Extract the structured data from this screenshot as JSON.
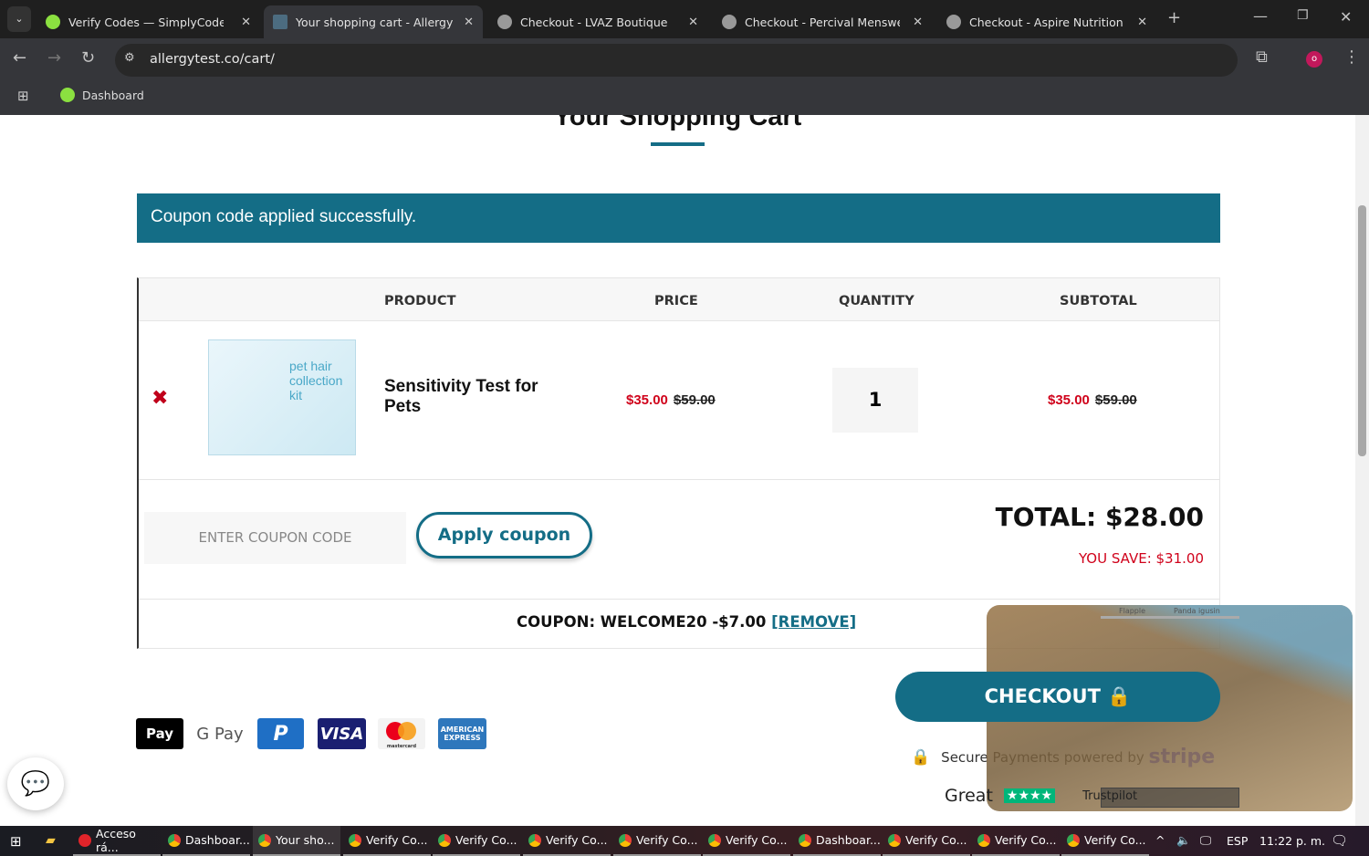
{
  "browser": {
    "tabs": [
      {
        "title": "Verify Codes — SimplyCodes",
        "active": false
      },
      {
        "title": "Your shopping cart - Allergy Test",
        "active": true
      },
      {
        "title": "Checkout - LVAZ Boutique",
        "active": false
      },
      {
        "title": "Checkout - Percival Menswear",
        "active": false
      },
      {
        "title": "Checkout - Aspire Nutrition",
        "active": false
      }
    ],
    "url": "allergytest.co/cart/",
    "bookmark": "Dashboard"
  },
  "page": {
    "title": "Your Shopping Cart",
    "notice": "Coupon code applied successfully.",
    "headers": {
      "product": "PRODUCT",
      "price": "PRICE",
      "quantity": "QUANTITY",
      "subtotal": "SUBTOTAL"
    },
    "item": {
      "name": "Sensitivity Test for Pets",
      "price": "$35.00",
      "old_price": "$59.00",
      "quantity": "1",
      "subtotal": "$35.00",
      "old_subtotal": "$59.00",
      "image_text": "pet hair collection kit"
    },
    "coupon_placeholder": "ENTER COUPON CODE",
    "apply_label": "Apply coupon",
    "total": "TOTAL: $28.00",
    "save": "YOU SAVE: $31.00",
    "coupon_line": "COUPON: WELCOME20 -$7.00",
    "remove_label": "[REMOVE]",
    "checkout_label": "CHECKOUT",
    "secure_text": "Secure Payments powered by",
    "stripe": "stripe",
    "rating": "Great",
    "trustpilot": "Trustpilot",
    "payment_methods": [
      "Pay",
      "G Pay",
      "P",
      "VISA",
      "mastercard",
      "AMERICAN EXPRESS"
    ]
  },
  "video": {
    "labels": [
      "Flapple",
      "Panda igusin"
    ]
  },
  "taskbar": {
    "items": [
      "Acceso rá...",
      "Dashboar...",
      "Your sho...",
      "Verify Co...",
      "Verify Co...",
      "Verify Co...",
      "Verify Co...",
      "Verify Co...",
      "Dashboar...",
      "Verify Co...",
      "Verify Co...",
      "Verify Co..."
    ],
    "lang": "ESP",
    "time": "11:22 p. m."
  },
  "colors": {
    "teal": "#146d86",
    "red": "#d0021b"
  }
}
